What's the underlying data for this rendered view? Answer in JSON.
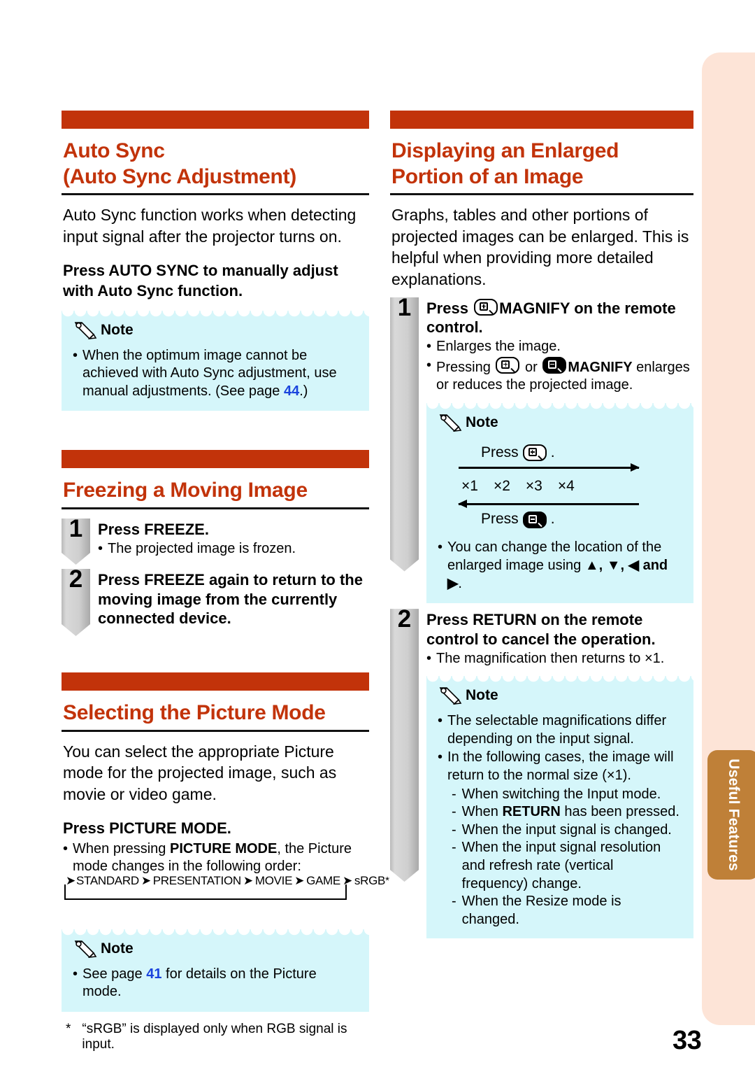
{
  "page": {
    "number": "33",
    "tab_label_line1": "Useful",
    "tab_label_line2": "Features"
  },
  "left_column": {
    "section1": {
      "title_line1": "Auto Sync",
      "title_line2": "(Auto Sync Adjustment)",
      "intro": "Auto Sync function works when detecting input signal after the projector turns on.",
      "lead_bold": "Press AUTO SYNC to manually adjust with Auto Sync function.",
      "lead_bold_pre": "Press ",
      "lead_bold_key": "AUTO SYNC",
      "lead_bold_post": " to manually adjust with Auto Sync function.",
      "note": {
        "label": "Note",
        "bullet1_pre": "When the optimum image cannot be achieved with Auto Sync adjustment, use manual adjustments. (See page ",
        "bullet1_page": "44",
        "bullet1_post": ".)"
      }
    },
    "section2": {
      "title": "Freezing a Moving Image",
      "steps": [
        {
          "number": "1",
          "title_pre": "Press ",
          "title_key": "FREEZE",
          "title_post": ".",
          "sub": "The projected image is frozen."
        },
        {
          "number": "2",
          "title_pre": "Press ",
          "title_key": "FREEZE",
          "title_post": " again to return to the moving image from the currently connected device.",
          "sub": ""
        }
      ]
    },
    "section3": {
      "title": "Selecting the Picture Mode",
      "intro": "You can select the appropriate Picture mode for the projected image, such as movie or video game.",
      "lead_pre": "Press ",
      "lead_key": "PICTURE MODE",
      "lead_post": ".",
      "bullet_pre": "When pressing ",
      "bullet_key": "PICTURE MODE",
      "bullet_post": ", the Picture mode changes in the following order:",
      "cycle": [
        "STANDARD",
        "PRESENTATION",
        "MOVIE",
        "GAME",
        "sRGB"
      ],
      "cycle_arrow": "➡",
      "cycle_star": "*",
      "note": {
        "label": "Note",
        "bullet1_pre": "See page ",
        "bullet1_page": "41",
        "bullet1_post": " for details on the Picture mode."
      },
      "footnote_marker": "*",
      "footnote_text": "“sRGB” is displayed only when RGB signal is input."
    }
  },
  "right_column": {
    "section1": {
      "title_line1": "Displaying an Enlarged",
      "title_line2": "Portion of an Image",
      "intro": "Graphs, tables and other portions of projected images can be enlarged. This is helpful when providing more detailed explanations.",
      "steps": [
        {
          "number": "1",
          "title_pre": "Press ",
          "title_key": "MAGNIFY",
          "title_post": " on the remote control.",
          "bullet1": "Enlarges the image.",
          "bullet2_pre": "Pressing ",
          "bullet2_or": "or",
          "bullet2_key": "MAGNIFY",
          "bullet2_post": " enlarges or reduces the projected image."
        },
        {
          "number": "2",
          "title_pre": "Press ",
          "title_key": "RETURN",
          "title_post": " on the remote control to cancel the operation.",
          "bullet1": "The magnification then returns to ×1."
        }
      ],
      "note1": {
        "label": "Note",
        "press_plus": "Press",
        "press_plus_post": ".",
        "press_minus": "Press",
        "press_minus_post": ".",
        "scale": [
          "×1",
          "×2",
          "×3",
          "×4"
        ],
        "bullet_pre": "You can change the location of the enlarged image using ",
        "bullet_arrows": "▲, ▼, ◀ and ▶",
        "bullet_post": "."
      },
      "note2": {
        "label": "Note",
        "bullet1": "The selectable magnifications differ depending on the input signal.",
        "bullet2": "In the following cases, the image will return to the normal size (×1).",
        "sub_items": [
          {
            "pre": "When switching the Input mode.",
            "key": "",
            "post": ""
          },
          {
            "pre": "When ",
            "key": "RETURN",
            "post": " has been pressed."
          },
          {
            "pre": "When the input signal is changed.",
            "key": "",
            "post": ""
          },
          {
            "pre": "When the input signal resolution and refresh rate (vertical frequency) change.",
            "key": "",
            "post": ""
          },
          {
            "pre": "When the Resize mode is changed.",
            "key": "",
            "post": ""
          }
        ],
        "sub_dash": "-"
      }
    }
  },
  "colors": {
    "accent_orange": "#c2330a",
    "note_bg": "#d5f6fa",
    "tab_brown": "#bf8038",
    "strip_peach": "#fde4d7",
    "page_link_blue": "#1a44dd"
  }
}
